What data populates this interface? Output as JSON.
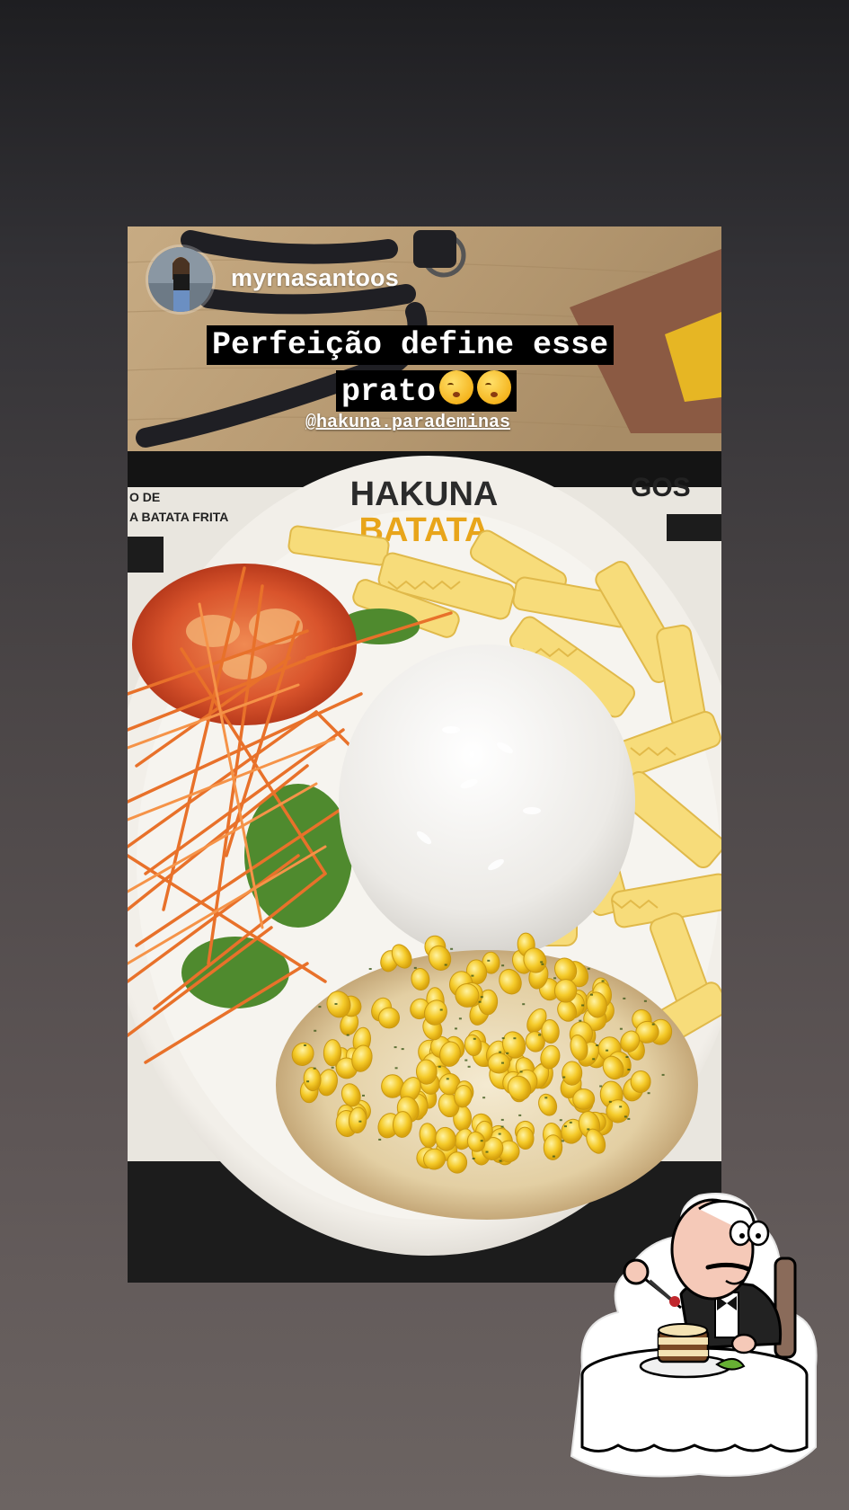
{
  "story": {
    "username": "myrnasantoos",
    "caption_line1": "Perfeição define esse",
    "caption_line2": "prato",
    "caption_emojis": [
      "relieved-kiss-emoji",
      "relieved-kiss-emoji"
    ],
    "mention": "@hakuna.parademinas",
    "plate_logo_line1": "HAKUNA",
    "plate_logo_line2": "BATATA",
    "placemat_text_line1": "O DE",
    "placemat_text_line2": "A BATATA FRITA",
    "placemat_text_right": "GOS"
  },
  "badge": {
    "icon": "dessert-mascot-icon"
  },
  "colors": {
    "caption_bg": "#000000",
    "caption_text": "#ffffff",
    "logo_dark": "#2b2b2b",
    "logo_yellow": "#e8a51a"
  }
}
